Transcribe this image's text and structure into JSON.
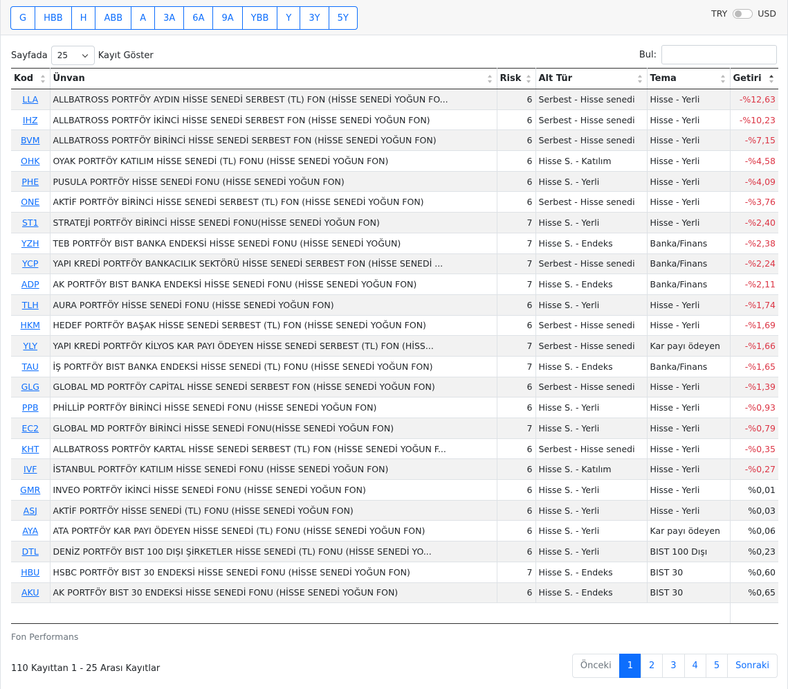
{
  "period_buttons": [
    "G",
    "HBB",
    "H",
    "ABB",
    "A",
    "3A",
    "6A",
    "9A",
    "YBB",
    "Y",
    "3Y",
    "5Y"
  ],
  "currency": {
    "left": "TRY",
    "right": "USD"
  },
  "length_control": {
    "prefix": "Sayfada",
    "value": "25",
    "suffix": "Kayıt Göster"
  },
  "search": {
    "label": "Bul:",
    "value": ""
  },
  "table": {
    "headers": [
      "Kod",
      "Ünvan",
      "Risk",
      "Alt Tür",
      "Tema",
      "Getiri"
    ],
    "rows": [
      [
        "LLA",
        "ALLBATROSS PORTFÖY AYDIN HİSSE SENEDİ SERBEST (TL) FON (HİSSE SENEDİ YOĞUN FO...",
        "6",
        "Serbest - Hisse senedi",
        "Hisse - Yerli",
        "-%12,63"
      ],
      [
        "IHZ",
        "ALLBATROSS PORTFÖY İKİNCİ HİSSE SENEDİ SERBEST FON (HİSSE SENEDİ YOĞUN FON)",
        "6",
        "Serbest - Hisse senedi",
        "Hisse - Yerli",
        "-%10,23"
      ],
      [
        "BVM",
        "ALLBATROSS PORTFÖY BİRİNCİ HİSSE SENEDİ SERBEST FON (HİSSE SENEDİ YOĞUN FON)",
        "6",
        "Serbest - Hisse senedi",
        "Hisse - Yerli",
        "-%7,15"
      ],
      [
        "OHK",
        "OYAK PORTFÖY KATILIM HİSSE SENEDİ (TL) FONU (HİSSE SENEDİ YOĞUN FON)",
        "6",
        "Hisse S. - Katılım",
        "Hisse - Yerli",
        "-%4,58"
      ],
      [
        "PHE",
        "PUSULA PORTFÖY HİSSE SENEDİ FONU (HİSSE SENEDİ YOĞUN FON)",
        "6",
        "Hisse S. - Yerli",
        "Hisse - Yerli",
        "-%4,09"
      ],
      [
        "ONE",
        "AKTİF PORTFÖY BİRİNCİ HİSSE SENEDİ SERBEST (TL) FON (HİSSE SENEDİ YOĞUN FON)",
        "6",
        "Serbest - Hisse senedi",
        "Hisse - Yerli",
        "-%3,76"
      ],
      [
        "ST1",
        "STRATEJİ PORTFÖY BİRİNCİ HİSSE SENEDİ FONU(HİSSE SENEDİ YOĞUN FON)",
        "7",
        "Hisse S. - Yerli",
        "Hisse - Yerli",
        "-%2,40"
      ],
      [
        "YZH",
        "TEB PORTFÖY BIST BANKA ENDEKSİ HİSSE SENEDİ FONU (HİSSE SENEDİ YOĞUN)",
        "7",
        "Hisse S. - Endeks",
        "Banka/Finans",
        "-%2,38"
      ],
      [
        "YCP",
        "YAPI KREDİ PORTFÖY BANKACILIK SEKTÖRÜ HİSSE SENEDİ SERBEST FON (HİSSE SENEDİ ...",
        "7",
        "Serbest - Hisse senedi",
        "Banka/Finans",
        "-%2,24"
      ],
      [
        "ADP",
        "AK PORTFÖY BIST BANKA ENDEKSİ HİSSE SENEDİ FONU (HİSSE SENEDİ YOĞUN FON)",
        "7",
        "Hisse S. - Endeks",
        "Banka/Finans",
        "-%2,11"
      ],
      [
        "TLH",
        "AURA PORTFÖY HİSSE SENEDİ FONU (HİSSE SENEDİ YOĞUN FON)",
        "6",
        "Hisse S. - Yerli",
        "Hisse - Yerli",
        "-%1,74"
      ],
      [
        "HKM",
        "HEDEF PORTFÖY BAŞAK HİSSE SENEDİ SERBEST (TL) FON (HİSSE SENEDİ YOĞUN FON)",
        "6",
        "Serbest - Hisse senedi",
        "Hisse - Yerli",
        "-%1,69"
      ],
      [
        "YLY",
        "YAPI KREDİ PORTFÖY KİLYOS KAR PAYI ÖDEYEN HİSSE SENEDİ SERBEST (TL) FON (HİSS...",
        "7",
        "Serbest - Hisse senedi",
        "Kar payı ödeyen",
        "-%1,66"
      ],
      [
        "TAU",
        "İŞ PORTFÖY BIST BANKA ENDEKSİ HİSSE SENEDİ (TL) FONU (HİSSE SENEDİ YOĞUN FON)",
        "7",
        "Hisse S. - Endeks",
        "Banka/Finans",
        "-%1,65"
      ],
      [
        "GLG",
        "GLOBAL MD PORTFÖY CAPİTAL HİSSE SENEDİ SERBEST FON (HİSSE SENEDİ YOĞUN FON)",
        "6",
        "Serbest - Hisse senedi",
        "Hisse - Yerli",
        "-%1,39"
      ],
      [
        "PPB",
        "PHİLLİP PORTFÖY BİRİNCİ HİSSE SENEDİ FONU (HİSSE SENEDİ YOĞUN FON)",
        "6",
        "Hisse S. - Yerli",
        "Hisse - Yerli",
        "-%0,93"
      ],
      [
        "EC2",
        "GLOBAL MD PORTFÖY BİRİNCİ HİSSE SENEDİ FONU(HİSSE SENEDİ YOĞUN FON)",
        "7",
        "Hisse S. - Yerli",
        "Hisse - Yerli",
        "-%0,79"
      ],
      [
        "KHT",
        "ALLBATROSS PORTFÖY KARTAL HİSSE SENEDİ SERBEST (TL) FON (HİSSE SENEDİ YOĞUN F...",
        "6",
        "Serbest - Hisse senedi",
        "Hisse - Yerli",
        "-%0,35"
      ],
      [
        "IVF",
        "İSTANBUL PORTFÖY KATILIM HİSSE SENEDİ FONU (HİSSE SENEDİ YOĞUN FON)",
        "6",
        "Hisse S. - Katılım",
        "Hisse - Yerli",
        "-%0,27"
      ],
      [
        "GMR",
        "INVEO PORTFÖY İKİNCİ HİSSE SENEDİ FONU (HİSSE SENEDİ YOĞUN FON)",
        "6",
        "Hisse S. - Yerli",
        "Hisse - Yerli",
        "%0,01"
      ],
      [
        "ASJ",
        "AKTİF PORTFÖY HİSSE SENEDİ (TL) FONU (HİSSE SENEDİ YOĞUN FON)",
        "6",
        "Hisse S. - Yerli",
        "Hisse - Yerli",
        "%0,03"
      ],
      [
        "AYA",
        "ATA PORTFÖY KAR PAYI ÖDEYEN HİSSE SENEDİ (TL) FONU (HİSSE SENEDİ YOĞUN FON)",
        "6",
        "Hisse S. - Yerli",
        "Kar payı ödeyen",
        "%0,06"
      ],
      [
        "DTL",
        "DENİZ PORTFÖY BIST 100 DIŞI ŞİRKETLER HİSSE SENEDİ (TL) FONU (HİSSE SENEDİ YO...",
        "6",
        "Hisse S. - Yerli",
        "BIST 100 Dışı",
        "%0,23"
      ],
      [
        "HBU",
        "HSBC PORTFÖY BIST 30 ENDEKSİ HİSSE SENEDİ FONU (HİSSE SENEDİ YOĞUN FON)",
        "7",
        "Hisse S. - Endeks",
        "BIST 30",
        "%0,60"
      ],
      [
        "AKU",
        "AK PORTFÖY BIST 30 ENDEKSİ HİSSE SENEDİ FONU (HİSSE SENEDİ YOĞUN FON)",
        "6",
        "Hisse S. - Endeks",
        "BIST 30",
        "%0,65"
      ]
    ]
  },
  "caption": "Fon Performans",
  "info": "110 Kayıttan 1 - 25 Arası Kayıtlar",
  "pagination": {
    "prev": "Önceki",
    "pages": [
      "1",
      "2",
      "3",
      "4",
      "5"
    ],
    "active": "1",
    "next": "Sonraki"
  },
  "colors": {
    "accent": "#0d6efd",
    "negative": "#dc3545",
    "stripe": "#f2f2f2"
  }
}
